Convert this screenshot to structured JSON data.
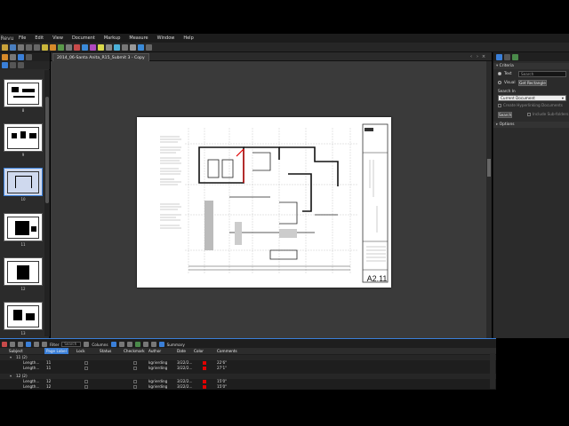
{
  "menu": {
    "logo": "Revu",
    "items": [
      "File",
      "Edit",
      "View",
      "Document",
      "Markup",
      "Measure",
      "Window",
      "Help"
    ]
  },
  "document": {
    "tab_title": "2014_06-Santa Anita_R15_Submit 3 - Copy",
    "sheet_number": "A2.11"
  },
  "thumbnails": [
    {
      "label": "8"
    },
    {
      "label": "9"
    },
    {
      "label": "10",
      "selected": true
    },
    {
      "label": "11"
    },
    {
      "label": "12"
    },
    {
      "label": "13"
    }
  ],
  "search_panel": {
    "criteria_label": "Criteria",
    "text_option": "Text",
    "search_placeholder": "Search",
    "visual_option": "Visual",
    "get_rectangle_label": "Get Rectangle",
    "search_in_label": "Search In",
    "search_in_value": "Current Document",
    "hyperlinking_label": "Create Hyperlinking Documents",
    "search_button": "Search",
    "include_subfolders": "Include Sub-folders",
    "options_label": "Options"
  },
  "markups_list": {
    "filter_label": "Filter",
    "search_placeholder": "Search",
    "columns_label": "Columns",
    "summary_label": "Summary",
    "headers": [
      "Subject",
      "Page Label",
      "Lock",
      "Status",
      "Checkmark",
      "Author",
      "Date",
      "Color",
      "Comments"
    ],
    "groups": [
      {
        "name": "11 (2)",
        "rows": [
          {
            "subject": "Length...",
            "page": "11",
            "author": "kgrierding",
            "date": "3/22/2...",
            "comment": "22'6\""
          },
          {
            "subject": "Length...",
            "page": "11",
            "author": "kgrierding",
            "date": "3/22/2...",
            "comment": "27'1\""
          }
        ]
      },
      {
        "name": "12 (2)",
        "rows": [
          {
            "subject": "Length...",
            "page": "12",
            "author": "kgrierding",
            "date": "3/22/2...",
            "comment": "15'0\""
          },
          {
            "subject": "Length...",
            "page": "12",
            "author": "kgrierding",
            "date": "3/22/2...",
            "comment": "15'0\""
          }
        ]
      }
    ]
  },
  "colors": {
    "accent": "#3a7fd8",
    "markup_red": "#e00000",
    "panel_bg": "#2b2b2b",
    "canvas_bg": "#3a3a3a"
  }
}
